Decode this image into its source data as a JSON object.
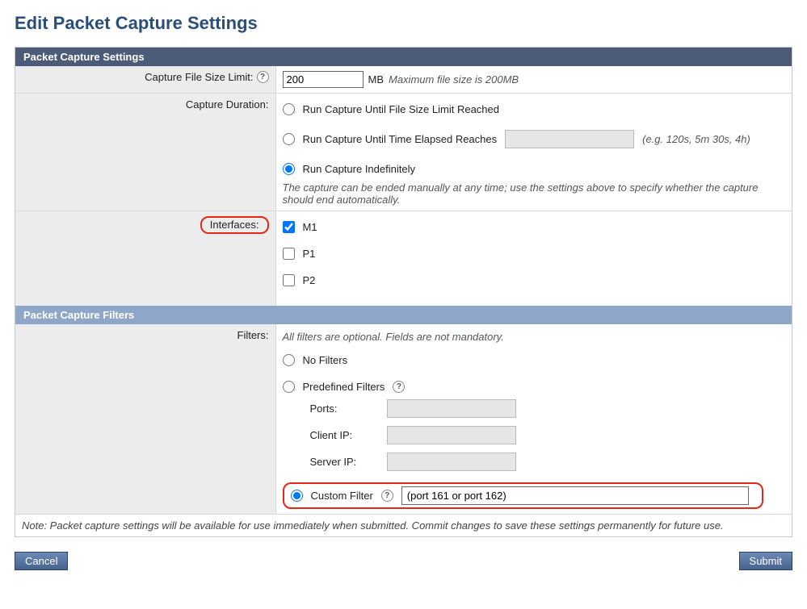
{
  "page": {
    "title": "Edit Packet Capture Settings"
  },
  "settings": {
    "header": "Packet Capture Settings",
    "size_limit": {
      "label": "Capture File Size Limit:",
      "value": "200",
      "unit": "MB",
      "hint": "Maximum file size is 200MB"
    },
    "duration": {
      "label": "Capture Duration:",
      "opt_size": "Run Capture Until File Size Limit Reached",
      "opt_time": "Run Capture Until Time Elapsed Reaches",
      "time_value": "",
      "time_hint": "(e.g. 120s, 5m 30s, 4h)",
      "opt_indef": "Run Capture Indefinitely",
      "note": "The capture can be ended manually at any time; use the settings above to specify whether the capture should end automatically."
    },
    "interfaces": {
      "label": "Interfaces:",
      "m1": "M1",
      "p1": "P1",
      "p2": "P2"
    }
  },
  "filters": {
    "header": "Packet Capture Filters",
    "label": "Filters:",
    "intro": "All filters are optional. Fields are not mandatory.",
    "opt_none": "No Filters",
    "opt_predefined": "Predefined Filters",
    "ports_label": "Ports:",
    "client_ip_label": "Client IP:",
    "server_ip_label": "Server IP:",
    "ports_value": "",
    "client_ip_value": "",
    "server_ip_value": "",
    "opt_custom": "Custom Filter",
    "custom_value": "(port 161 or port 162)"
  },
  "footnote": "Note: Packet capture settings will be available for use immediately when submitted. Commit changes to save these settings permanently for future use.",
  "buttons": {
    "cancel": "Cancel",
    "submit": "Submit"
  }
}
